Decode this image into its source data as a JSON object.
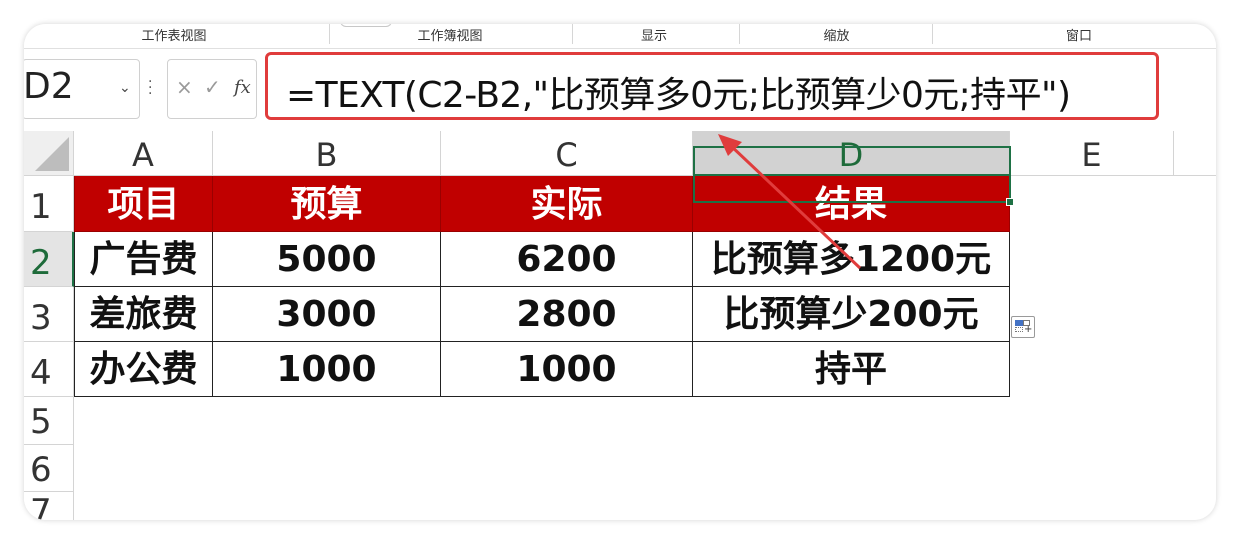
{
  "ribbon": {
    "groups": [
      "工作表视图",
      "工作簿视图",
      "显示",
      "缩放",
      "窗口"
    ]
  },
  "formula_bar": {
    "name_box": "D2",
    "cancel_symbol": "×",
    "enter_symbol": "✓",
    "fx_label": "fx",
    "formula": "=TEXT(C2-B2,\"比预算多0元;比预算少0元;持平\")"
  },
  "columns": [
    "A",
    "B",
    "C",
    "D",
    "E"
  ],
  "rows": [
    "1",
    "2",
    "3",
    "4",
    "5",
    "6",
    "7"
  ],
  "table": {
    "headers": [
      "项目",
      "预算",
      "实际",
      "结果"
    ],
    "rows": [
      [
        "广告费",
        "5000",
        "6200",
        "比预算多1200元"
      ],
      [
        "差旅费",
        "3000",
        "2800",
        "比预算少200元"
      ],
      [
        "办公费",
        "1000",
        "1000",
        "持平"
      ]
    ]
  },
  "selection": {
    "cell": "D2"
  },
  "colors": {
    "header_fill": "#c00000",
    "header_text": "#ffffff",
    "highlight_box": "#e03c3c",
    "arrow": "#e03c3c",
    "active_border": "#1e7145"
  },
  "icons": {
    "dropdown": "chevron-down-icon",
    "quick_analysis": "quick-analysis-icon"
  }
}
